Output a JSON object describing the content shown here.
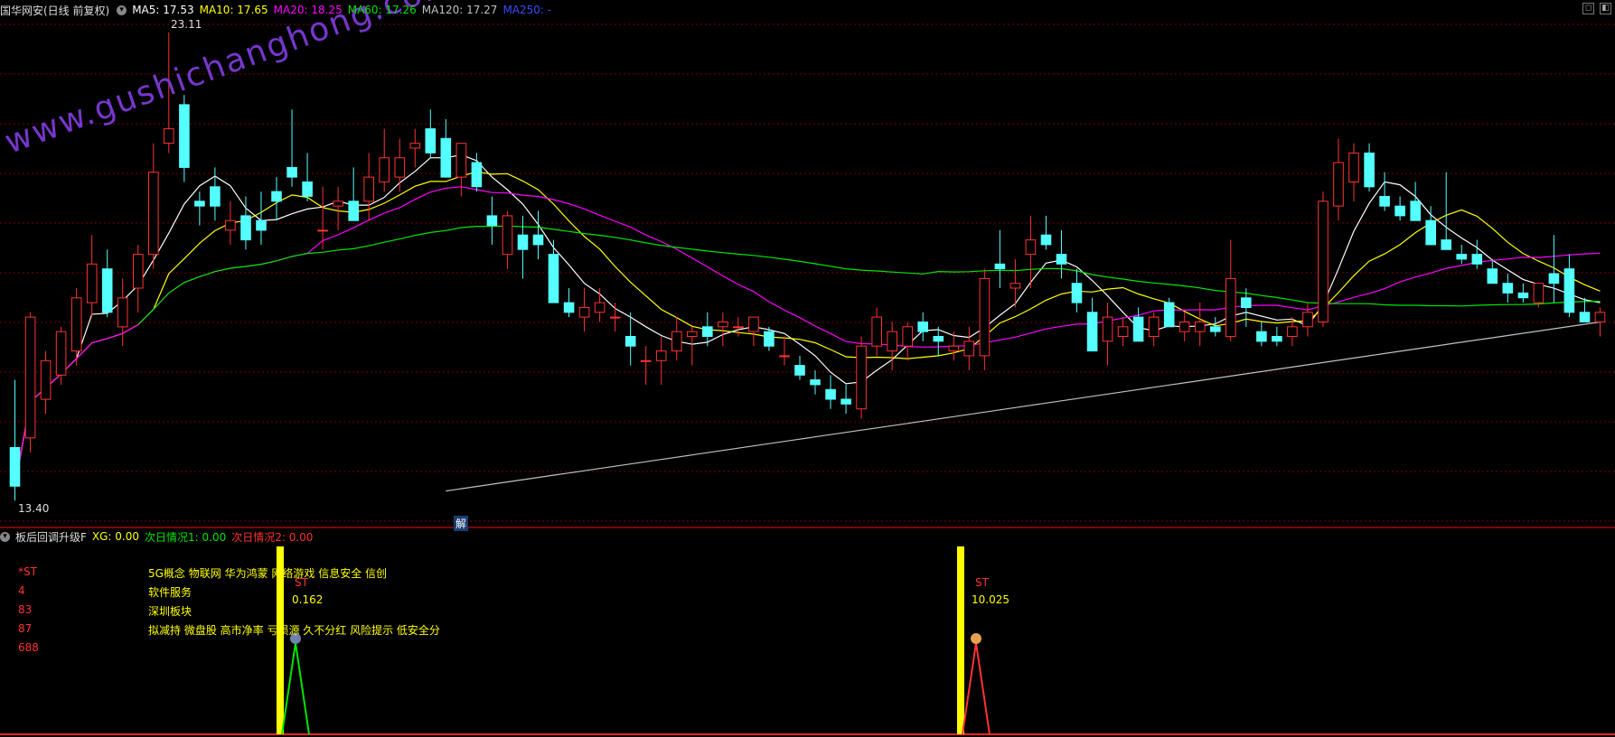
{
  "header": {
    "title": "国华网安(日线 前复权)",
    "ma5": "MA5: 17.53",
    "ma10": "MA10: 17.65",
    "ma20": "MA20: 18.25",
    "ma60": "MA60: 17.26",
    "ma120": "MA120: 17.27",
    "ma250": "MA250: -"
  },
  "colors": {
    "up": "#ff3232",
    "down": "#54ffff",
    "ma5": "#ffffff",
    "ma10": "#ffff00",
    "ma20": "#ff00ff",
    "ma60": "#00e600",
    "ma120": "#c0c0c0",
    "grid": "#7a0000"
  },
  "price_labels": {
    "high": "23.11",
    "low": "13.40"
  },
  "marker_jie": "解",
  "watermark": "www.gushichanghong.com",
  "indicator": {
    "name": "板后回调升级F",
    "xg": "XG: 0.00",
    "next1": "次日情况1: 0.00",
    "next2": "次日情况2: 0.00"
  },
  "info_left": [
    "*ST",
    "4",
    "83",
    "87",
    "688"
  ],
  "info_right": [
    "5G概念 物联网 华为鸿蒙 网络游戏 信息安全 信创",
    "软件服务",
    "深圳板块",
    "拟减持 微盘股 高市净率 亏损源 久不分红 风险提示 低安全分"
  ],
  "signals": [
    {
      "label": "ST",
      "value": "0.162"
    },
    {
      "label": "ST",
      "value": "10.025"
    }
  ],
  "chart_data": {
    "type": "candlestick",
    "ohlc": [
      [
        14.5,
        15.9,
        13.4,
        13.7
      ],
      [
        14.7,
        17.3,
        14.4,
        17.2
      ],
      [
        15.5,
        16.5,
        15.2,
        16.3
      ],
      [
        16.0,
        17.0,
        15.8,
        16.9
      ],
      [
        16.5,
        17.8,
        16.2,
        17.6
      ],
      [
        17.5,
        18.9,
        17.2,
        18.3
      ],
      [
        18.2,
        18.6,
        17.2,
        17.3
      ],
      [
        17.0,
        18.0,
        16.6,
        17.6
      ],
      [
        17.8,
        18.7,
        17.3,
        18.5
      ],
      [
        18.5,
        20.8,
        18.2,
        20.2
      ],
      [
        20.8,
        23.1,
        20.6,
        21.1
      ],
      [
        21.6,
        21.8,
        20.0,
        20.3
      ],
      [
        19.6,
        19.8,
        19.1,
        19.5
      ],
      [
        19.9,
        20.3,
        19.2,
        19.5
      ],
      [
        19.0,
        19.6,
        18.7,
        19.2
      ],
      [
        19.3,
        19.7,
        18.6,
        18.8
      ],
      [
        19.2,
        19.8,
        18.7,
        19.0
      ],
      [
        19.8,
        20.1,
        19.2,
        19.6
      ],
      [
        20.3,
        21.5,
        19.9,
        20.1
      ],
      [
        20.0,
        20.6,
        19.6,
        19.7
      ],
      [
        19.0,
        19.9,
        18.6,
        19.0
      ],
      [
        19.5,
        19.9,
        19.0,
        19.6
      ],
      [
        19.6,
        20.3,
        19.2,
        19.2
      ],
      [
        19.6,
        20.6,
        19.2,
        20.1
      ],
      [
        20.0,
        21.1,
        19.8,
        20.5
      ],
      [
        20.1,
        20.9,
        19.8,
        20.5
      ],
      [
        20.7,
        21.1,
        20.3,
        20.8
      ],
      [
        21.1,
        21.5,
        20.5,
        20.6
      ],
      [
        20.9,
        21.3,
        20.3,
        20.1
      ],
      [
        20.1,
        20.7,
        19.7,
        20.8
      ],
      [
        20.4,
        20.6,
        19.8,
        19.9
      ],
      [
        19.3,
        19.7,
        18.7,
        19.1
      ],
      [
        18.5,
        19.4,
        18.2,
        19.3
      ],
      [
        18.9,
        19.3,
        18.0,
        18.6
      ],
      [
        18.9,
        19.4,
        18.4,
        18.7
      ],
      [
        18.5,
        18.8,
        18.0,
        17.5
      ],
      [
        17.5,
        17.8,
        17.2,
        17.3
      ],
      [
        17.2,
        17.8,
        16.9,
        17.4
      ],
      [
        17.3,
        17.8,
        17.1,
        17.5
      ],
      [
        17.2,
        17.5,
        16.9,
        17.2
      ],
      [
        16.8,
        17.3,
        16.2,
        16.6
      ],
      [
        16.3,
        16.6,
        15.8,
        16.3
      ],
      [
        16.3,
        16.8,
        15.8,
        16.5
      ],
      [
        16.5,
        17.2,
        16.3,
        16.9
      ],
      [
        16.8,
        17.0,
        16.2,
        16.9
      ],
      [
        17.0,
        17.3,
        16.6,
        16.8
      ],
      [
        17.0,
        17.3,
        16.6,
        17.1
      ],
      [
        17.0,
        17.2,
        16.8,
        17.0
      ],
      [
        16.9,
        17.2,
        16.6,
        17.2
      ],
      [
        16.9,
        17.0,
        16.5,
        16.6
      ],
      [
        16.4,
        16.8,
        16.2,
        16.4
      ],
      [
        16.2,
        16.4,
        15.9,
        16.0
      ],
      [
        15.9,
        16.1,
        15.6,
        15.8
      ],
      [
        15.7,
        16.0,
        15.3,
        15.5
      ],
      [
        15.5,
        15.8,
        15.2,
        15.4
      ],
      [
        15.3,
        16.8,
        15.1,
        16.6
      ],
      [
        16.6,
        17.4,
        16.4,
        17.2
      ],
      [
        16.5,
        17.1,
        16.1,
        16.9
      ],
      [
        16.6,
        17.1,
        16.3,
        17.0
      ],
      [
        17.1,
        17.3,
        16.7,
        16.9
      ],
      [
        16.8,
        17.0,
        16.4,
        16.7
      ],
      [
        16.5,
        16.9,
        16.3,
        16.6
      ],
      [
        16.4,
        17.0,
        16.1,
        16.7
      ],
      [
        16.4,
        18.2,
        16.1,
        18.0
      ],
      [
        18.3,
        19.0,
        17.8,
        18.2
      ],
      [
        17.8,
        18.4,
        17.4,
        17.9
      ],
      [
        18.5,
        19.3,
        17.8,
        18.8
      ],
      [
        18.9,
        19.3,
        18.6,
        18.7
      ],
      [
        18.5,
        19.0,
        18.0,
        18.3
      ],
      [
        17.9,
        18.2,
        17.3,
        17.5
      ],
      [
        17.3,
        17.6,
        16.7,
        16.5
      ],
      [
        16.7,
        17.5,
        16.2,
        17.2
      ],
      [
        16.8,
        17.2,
        16.6,
        17.0
      ],
      [
        17.2,
        17.4,
        16.9,
        16.7
      ],
      [
        16.8,
        17.3,
        16.6,
        17.2
      ],
      [
        17.5,
        17.6,
        17.0,
        17.0
      ],
      [
        16.9,
        17.3,
        16.7,
        17.1
      ],
      [
        16.9,
        17.5,
        16.6,
        17.1
      ],
      [
        17.0,
        17.2,
        16.8,
        16.9
      ],
      [
        16.8,
        18.8,
        16.7,
        18.0
      ],
      [
        17.6,
        17.8,
        17.0,
        17.4
      ],
      [
        16.9,
        17.1,
        16.6,
        16.7
      ],
      [
        16.8,
        17.0,
        16.6,
        16.7
      ],
      [
        16.8,
        17.2,
        16.6,
        17.0
      ],
      [
        17.0,
        17.5,
        16.8,
        17.3
      ],
      [
        17.1,
        19.8,
        17.0,
        19.6
      ],
      [
        19.5,
        20.9,
        19.2,
        20.4
      ],
      [
        20.0,
        20.8,
        19.6,
        20.6
      ],
      [
        20.6,
        20.8,
        19.8,
        19.9
      ],
      [
        19.7,
        20.2,
        19.4,
        19.5
      ],
      [
        19.5,
        19.7,
        19.2,
        19.3
      ],
      [
        19.6,
        20.0,
        19.2,
        19.2
      ],
      [
        19.2,
        19.5,
        18.9,
        18.7
      ],
      [
        18.8,
        20.2,
        18.6,
        18.6
      ],
      [
        18.5,
        18.7,
        18.3,
        18.4
      ],
      [
        18.5,
        18.8,
        18.2,
        18.3
      ],
      [
        18.2,
        18.4,
        17.9,
        17.9
      ],
      [
        17.9,
        18.1,
        17.5,
        17.7
      ],
      [
        17.7,
        17.9,
        17.5,
        17.6
      ],
      [
        17.5,
        17.8,
        17.4,
        17.9
      ],
      [
        18.1,
        18.9,
        17.5,
        17.9
      ],
      [
        18.2,
        18.5,
        17.2,
        17.3
      ],
      [
        17.3,
        17.6,
        17.2,
        17.1
      ],
      [
        17.1,
        17.4,
        16.8,
        17.3
      ]
    ],
    "grid": true
  }
}
